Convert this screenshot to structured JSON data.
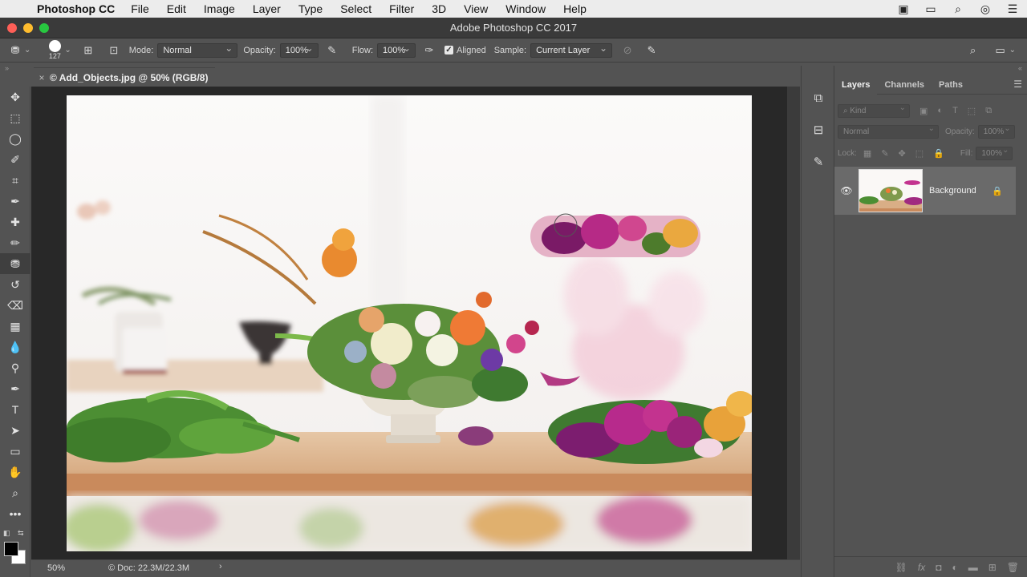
{
  "menubar": {
    "app_name": "Photoshop CC",
    "items": [
      "File",
      "Edit",
      "Image",
      "Layer",
      "Type",
      "Select",
      "Filter",
      "3D",
      "View",
      "Window",
      "Help"
    ]
  },
  "window": {
    "title": "Adobe Photoshop CC 2017"
  },
  "options_bar": {
    "brush_size": "127",
    "mode_label": "Mode:",
    "mode_value": "Normal",
    "opacity_label": "Opacity:",
    "opacity_value": "100%",
    "flow_label": "Flow:",
    "flow_value": "100%",
    "aligned_label": "Aligned",
    "aligned_checked": true,
    "sample_label": "Sample:",
    "sample_value": "Current Layer"
  },
  "document": {
    "tab_title": "© Add_Objects.jpg @ 50% (RGB/8)",
    "close_glyph": "×"
  },
  "status_bar": {
    "zoom": "50%",
    "doc_info": "© Doc: 22.3M/22.3M"
  },
  "layers_panel": {
    "tabs": [
      "Layers",
      "Channels",
      "Paths"
    ],
    "active_tab": "Layers",
    "filter_placeholder": "Kind",
    "blend_mode": "Normal",
    "opacity_label": "Opacity:",
    "opacity_value": "100%",
    "lock_label": "Lock:",
    "fill_label": "Fill:",
    "fill_value": "100%",
    "layers": [
      {
        "name": "Background",
        "visible": true,
        "locked": true
      }
    ]
  },
  "colors": {
    "accent_close": "#fe5f57",
    "accent_minimize": "#febc2e",
    "accent_zoom": "#28c840",
    "ui_dark": "#535353",
    "pasteboard": "#282828"
  }
}
